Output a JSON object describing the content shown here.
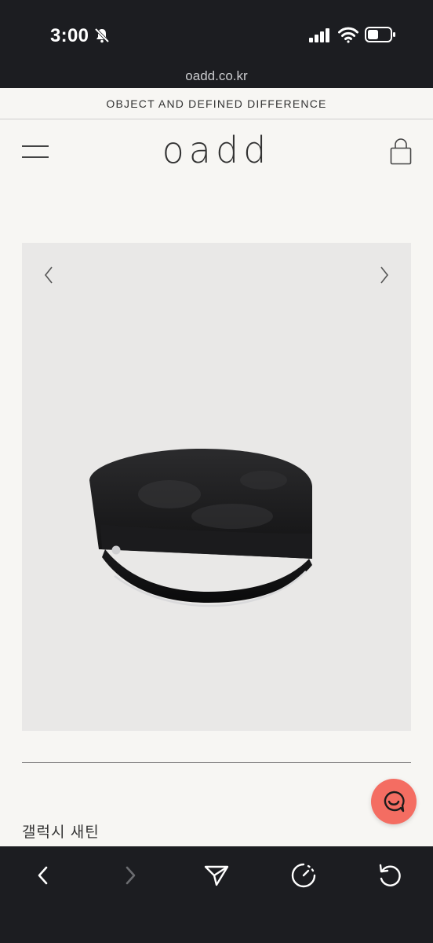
{
  "status_bar": {
    "time": "3:00",
    "icons": [
      "bell-slash-icon",
      "signal-icon",
      "wifi-icon",
      "battery-icon"
    ]
  },
  "browser": {
    "url": "oadd.co.kr"
  },
  "site": {
    "tagline": "OBJECT AND DEFINED DIFFERENCE",
    "logo_text": "oadd",
    "icons": [
      "hamburger-menu-icon",
      "shopping-bag-icon"
    ]
  },
  "product": {
    "name": "갤럭시 새틴",
    "carousel_icons": [
      "chevron-left-icon",
      "chevron-right-icon"
    ]
  },
  "chat_button": {
    "icon": "chat-bubble-icon",
    "color": "#f46d62"
  },
  "toolbar": {
    "icons": [
      "back-arrow-icon",
      "forward-arrow-icon",
      "share-send-icon",
      "speed-dial-icon",
      "reload-icon"
    ]
  },
  "colors": {
    "page_background": "#f7f6f3",
    "chrome_background": "#1c1d21",
    "carousel_background": "#e9e8e7"
  }
}
